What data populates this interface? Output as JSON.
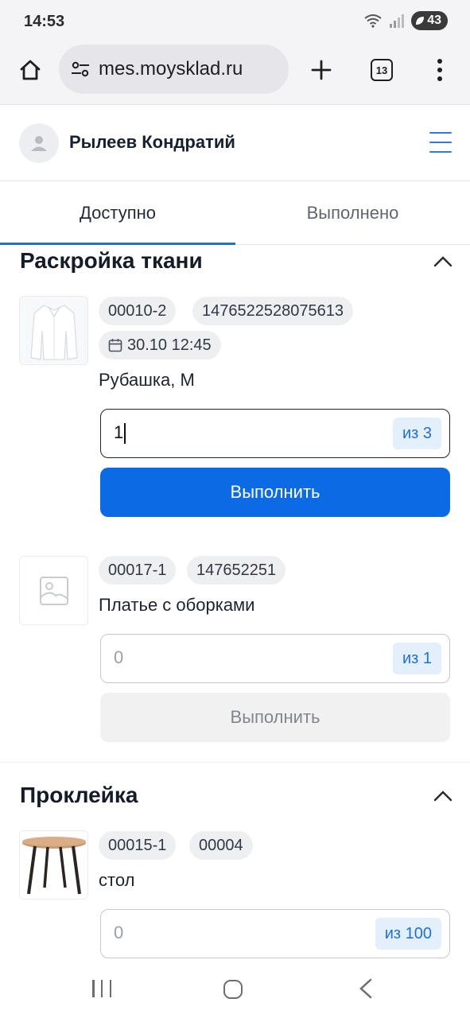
{
  "status_bar": {
    "time": "14:53",
    "battery": "43"
  },
  "browser": {
    "url": "mes.moysklad.ru",
    "tabs_count": "13"
  },
  "header": {
    "user_name": "Рылеев Кондратий"
  },
  "tabs": [
    {
      "label": "Доступно",
      "active": true
    },
    {
      "label": "Выполнено",
      "active": false
    }
  ],
  "sections": [
    {
      "title": "Раскройка ткани",
      "items": [
        {
          "chips": [
            "00010-2",
            "1476522528075613"
          ],
          "date_chip": "30.10 12:45",
          "name": "Рубашка, М",
          "qty_value": "1",
          "qty_of": "из 3",
          "button": "Выполнить",
          "thumb": "shirt-image"
        },
        {
          "chips": [
            "00017-1",
            "147652251"
          ],
          "name": "Платье с оборками",
          "qty_value": "0",
          "qty_of": "из 1",
          "button": "Выполнить",
          "thumb": "image-placeholder-icon"
        }
      ]
    },
    {
      "title": "Проклейка",
      "items": [
        {
          "chips": [
            "00015-1",
            "00004"
          ],
          "name": "стол",
          "qty_value": "0",
          "qty_of": "из 100",
          "thumb": "table-image"
        }
      ]
    }
  ],
  "colors": {
    "primary": "#0d6ae5",
    "accent_link": "#1f6fd6",
    "chip_bg": "#eeeff1"
  }
}
